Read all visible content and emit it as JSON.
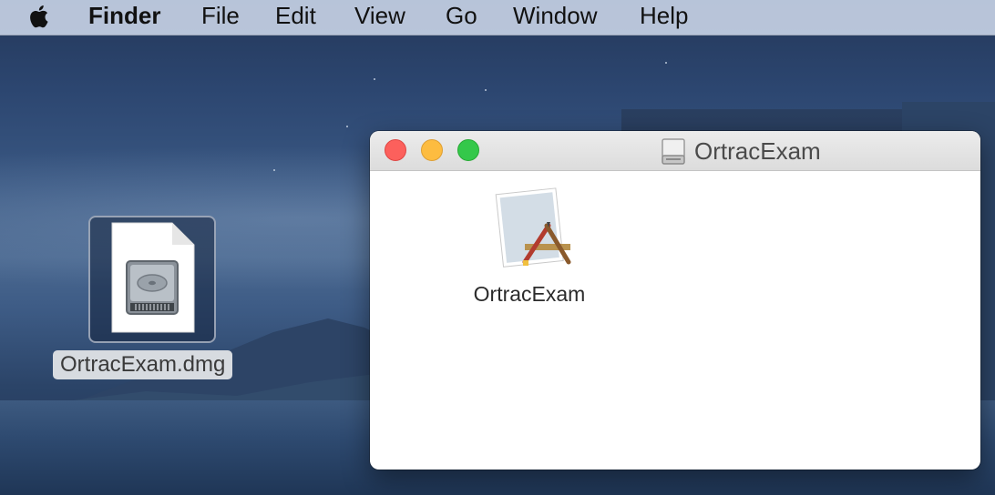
{
  "menubar": {
    "apple_menu": "apple-menu",
    "items": [
      "Finder",
      "File",
      "Edit",
      "View",
      "Go",
      "Window",
      "Help"
    ]
  },
  "desktop": {
    "dmg_file": {
      "label": "OrtracExam.dmg",
      "icon": "disk-image-icon"
    }
  },
  "window": {
    "title": "OrtracExam",
    "title_icon": "volume-drive-icon",
    "buttons": [
      "close",
      "minimize",
      "zoom"
    ],
    "items": [
      {
        "label": "OrtracExam",
        "icon": "installer-app-icon"
      }
    ]
  },
  "colors": {
    "close": "#fc605c",
    "minimize": "#fdbc40",
    "zoom": "#34c84a",
    "menubar": "#c4d0e4"
  }
}
